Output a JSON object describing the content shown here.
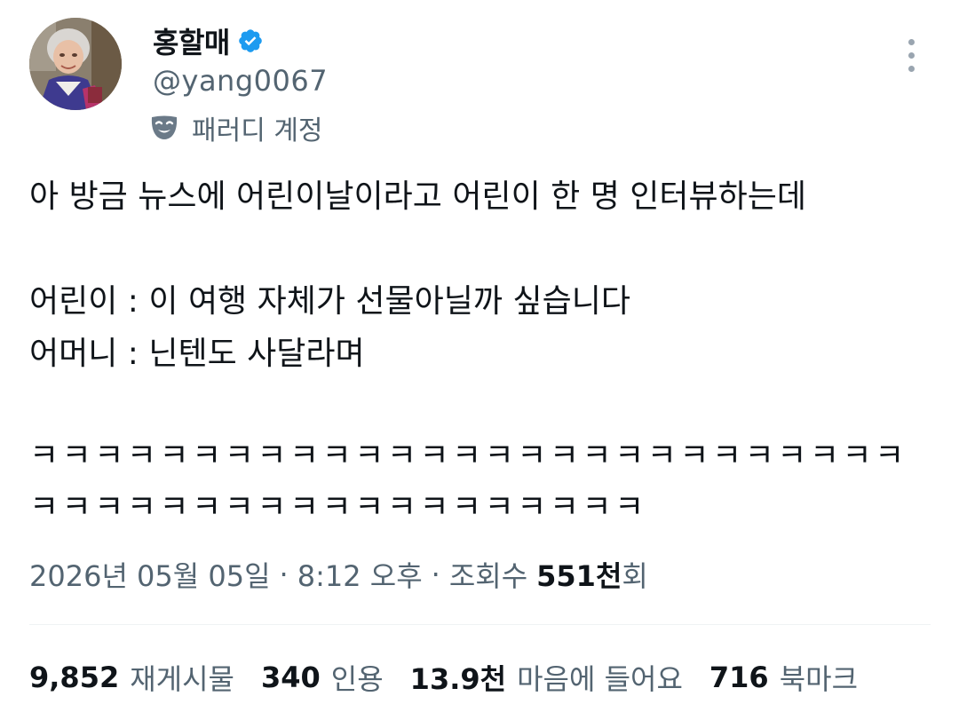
{
  "author": {
    "display_name": "홍할매",
    "handle": "@yang0067",
    "parody_label": "패러디 계정",
    "verified_color": "#1d9bf0"
  },
  "tweet": {
    "lines": [
      "아 방금 뉴스에 어린이날이라고 어린이 한 명 인터뷰하는데",
      "어린이 : 이 여행 자체가 선물아닐까 싶습니다",
      "어머니 : 닌텐도 사달라며",
      "ㅋㅋㅋㅋㅋㅋㅋㅋㅋㅋㅋㅋㅋㅋㅋㅋㅋㅋㅋㅋㅋㅋㅋㅋㅋㅋㅋ",
      "ㅋㅋㅋㅋㅋㅋㅋㅋㅋㅋㅋㅋㅋㅋㅋㅋㅋㅋㅋ"
    ]
  },
  "meta": {
    "date": "2026년 05월 05일",
    "time": "8:12 오후",
    "separator": "·",
    "views_label": "조회수",
    "views_value": "551천",
    "views_suffix": "회"
  },
  "stats": {
    "retweets": {
      "value": "9,852",
      "label": "재게시물"
    },
    "quotes": {
      "value": "340",
      "label": "인용"
    },
    "likes": {
      "value": "13.9천",
      "label": "마음에 들어요"
    },
    "bookmarks": {
      "value": "716",
      "label": "북마크"
    }
  },
  "icons": {
    "verified": "verified-badge-icon",
    "parody": "theater-mask-icon",
    "more": "more-options-icon"
  },
  "colors": {
    "text_primary": "#0f1419",
    "text_secondary": "#536471",
    "accent": "#1d9bf0",
    "divider": "#eff3f4"
  }
}
